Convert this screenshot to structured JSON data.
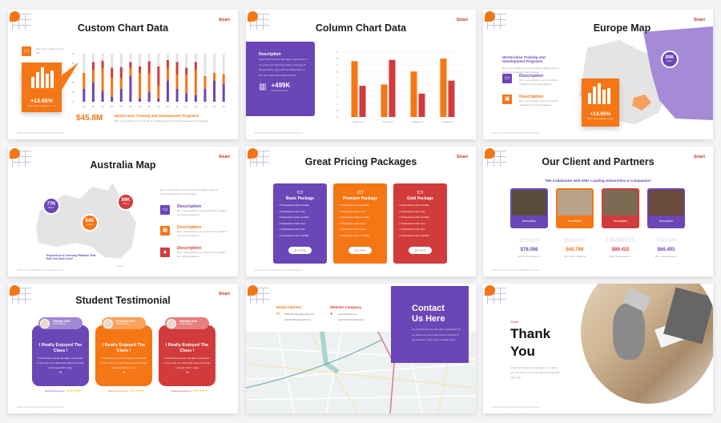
{
  "common": {
    "brand": "Smart",
    "footer": "©2022 Learning Platform All Rights Reserved",
    "accent_colors": {
      "purple": "#6b46b6",
      "orange": "#f57614",
      "red": "#d23b3b"
    }
  },
  "s1": {
    "title": "Custom Chart Data",
    "icon_text": "But I must explain how all this",
    "stat": "+13.65%",
    "stat_caption": "But I must explain to you",
    "amount": "$45.8M",
    "headline": "World-class Training and Development Programs",
    "body": "But I must explain to you how all this mistaken idea of denouncing pleasure and praising"
  },
  "s2": {
    "title": "Column Chart Data",
    "desc_title": "Description",
    "desc_body": "A wonderful serenity has taken possession of my entire soul, like these sweet mornings of spring which I enjoy with my whole heart. In this spot which was created for this",
    "stat": "+499K",
    "stat_caption": "A wonderful set"
  },
  "s3": {
    "title": "Europe Map",
    "headline": "World-class Training and Development Programs",
    "body": "But I must explain to you how all this mistaken idea of denouncing pleasure and praising",
    "items": [
      {
        "title": "Description",
        "body": "But I must explain to you how all this mistaken denouncing pleasure",
        "icon": "monitor-icon"
      },
      {
        "title": "Description",
        "body": "But I must explain to you how all this mistaken denouncing pleasure",
        "icon": "briefcase-icon"
      }
    ],
    "pin": {
      "value": "89K",
      "label": "Data 1"
    },
    "stat": "+13.65%",
    "stat_caption": "But I must explain to you"
  },
  "s4": {
    "title": "Australia Map",
    "intro": "But I must explain to you how all this mistaken idea of denouncing pleasure and praising",
    "quote": "\"Experience a Learning Platform That Take You Next Level\"",
    "pins": [
      {
        "value": "77K",
        "label": "Data 1"
      },
      {
        "value": "64K",
        "label": "Data 2"
      },
      {
        "value": "89K",
        "label": "Data 3"
      }
    ],
    "items": [
      {
        "title": "Description",
        "body": "But I must explain to you how all this mistaken denouncing pleasure",
        "icon": "monitor-icon"
      },
      {
        "title": "Description",
        "body": "But I must explain to you how all this mistaken denouncing pleasure",
        "icon": "briefcase-icon"
      },
      {
        "title": "Description",
        "body": "But I must explain to you how all this mistaken denouncing pleasure",
        "icon": "graduation-cap-icon"
      }
    ]
  },
  "s5": {
    "title": "Great Pricing Packages",
    "packages": [
      {
        "name": "Basic Package",
        "price": "$2,999",
        "features": [
          "Possession entire soul like",
          "Possession entire soul",
          "Possession entire soul like",
          "Possession entire soul",
          "Possession entire soul",
          "Possession entire soul like"
        ]
      },
      {
        "name": "Premium Package",
        "price": "$3,999",
        "features": [
          "Possession entire soul like",
          "Possession entire soul",
          "Possession entire soul like",
          "Possession entire soul",
          "Possession entire soul",
          "Possession entire soul like"
        ]
      },
      {
        "name": "Gold Package",
        "price": "$5,999",
        "features": [
          "Possession entire soul like",
          "Possession entire soul",
          "Possession entire soul like",
          "Possession entire soul",
          "Possession entire soul",
          "Possession entire soul like"
        ]
      }
    ]
  },
  "s6": {
    "title": "Our Client and Partners",
    "subtitle": "\"We Collaborate with 200+ Leading Universities & Companies\"",
    "partners": [
      {
        "label": "Description",
        "logo": "donate",
        "amount": "$78.098",
        "caption": "But I must explain to"
      },
      {
        "label": "Description",
        "logo": "Bakerei",
        "amount": "$45.788",
        "caption": "But I must explain to"
      },
      {
        "label": "Description",
        "logo": "FRAME•S",
        "amount": "$89.432",
        "caption": "But I must explain to"
      },
      {
        "label": "Description",
        "logo": "Vaccin•",
        "amount": "$66.493",
        "caption": "But I must explain to"
      }
    ]
  },
  "s7": {
    "title": "Student Testimonial",
    "cards": [
      {
        "name": "Alayan Doe",
        "role": "Smart Student",
        "headline": "I Really Enjoyed The Class !",
        "body": "A wonderful serenity has taken possession of my entire soul, like these sweet mornings of spring which I enjoy",
        "rating_label": "Rating Experience :",
        "stars": 5
      },
      {
        "name": "Richard Doe",
        "role": "Smart Student",
        "headline": "I Really Enjoyed The Class !",
        "body": "A wonderful serenity has taken possession of my entire soul, like these sweet mornings of spring which I enjoy",
        "rating_label": "Rating Experience :",
        "stars": 5
      },
      {
        "name": "Sandra Doe",
        "role": "Smart Student",
        "headline": "I Really Enjoyed The Class !",
        "body": "A wonderful serenity has taken possession of my entire soul, like these sweet mornings of spring which I enjoy",
        "rating_label": "Rating Experience :",
        "stars": 5
      }
    ]
  },
  "s8": {
    "email_label": "Email Address",
    "emails": [
      "officialmessage@email.com",
      "branchoffice@email.com"
    ],
    "web_label": "Website Company",
    "webs": [
      "www.website.com",
      "www.branchwebsite.com"
    ],
    "title": "Contact Us Here",
    "body": "A wonderful serenity has taken possession of my entire soul, like these sweet mornings of spring which I enjoy with my whole heart."
  },
  "s9": {
    "brand": "Smart",
    "title": "Thank You",
    "body": "A wonderful serenity possession of my entire soul, like these sweet mornings of spring which enjoy with"
  },
  "chart_data": [
    {
      "type": "bar",
      "stacked": true,
      "categories": [
        "01",
        "02",
        "03",
        "04",
        "05",
        "06",
        "07",
        "08",
        "09",
        "10",
        "11",
        "12",
        "13",
        "14",
        "15",
        "16"
      ],
      "ylim": [
        0,
        75
      ],
      "yticks": [
        0,
        15,
        30,
        45,
        60,
        75
      ],
      "series": [
        {
          "color": "#6b46b6",
          "values": [
            20,
            30,
            17,
            8,
            20,
            40,
            5,
            15,
            5,
            33,
            20,
            13,
            10,
            20,
            33,
            28
          ]
        },
        {
          "color": "#f57614",
          "values": [
            25,
            20,
            35,
            30,
            17,
            12,
            40,
            30,
            20,
            20,
            22,
            30,
            40,
            20,
            12,
            15
          ]
        },
        {
          "color": "#d23b3b",
          "values": [
            0,
            12,
            12,
            15,
            17,
            10,
            10,
            18,
            30,
            12,
            20,
            10,
            12,
            0,
            0,
            0
          ]
        }
      ],
      "remainder_color": "#e3e3e3"
    },
    {
      "type": "bar",
      "categories": [
        "Category 1",
        "Category 2",
        "Category 3",
        "Category 4"
      ],
      "ylim": [
        0,
        5
      ],
      "yticks": [
        0,
        0.5,
        1,
        1.5,
        2,
        2.5,
        3,
        3.5,
        4,
        4.5,
        5
      ],
      "grid": true,
      "series": [
        {
          "color": "#f57614",
          "values": [
            4.3,
            2.5,
            3.5,
            4.5
          ]
        },
        {
          "color": "#d23b3b",
          "values": [
            2.4,
            4.4,
            1.8,
            2.8
          ]
        }
      ]
    }
  ]
}
